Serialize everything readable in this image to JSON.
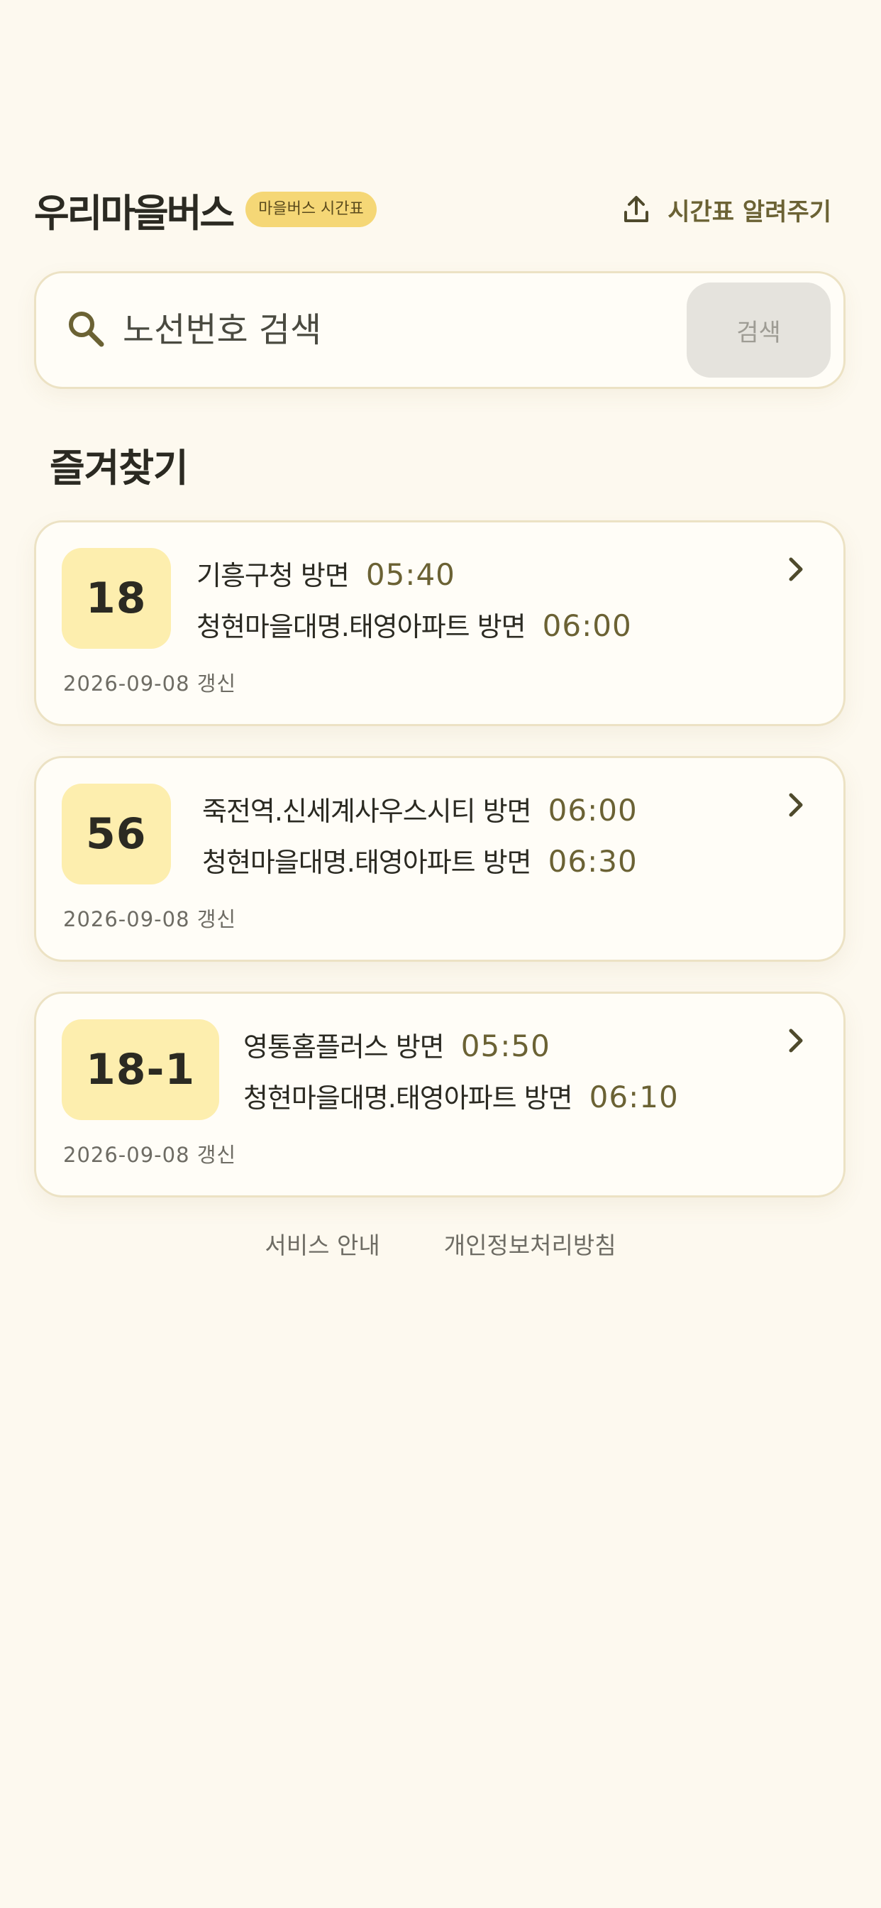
{
  "header": {
    "title": "우리마을버스",
    "badge": "마을버스 시간표",
    "share_label": "시간표 알려주기",
    "share_icon": "upload-icon"
  },
  "search": {
    "placeholder": "노선번호 검색",
    "button_label": "검색",
    "icon": "search-icon"
  },
  "favorites": {
    "title": "즐겨찾기",
    "routes": [
      {
        "number": "18",
        "directions": [
          {
            "name": "기흥구청 방면",
            "time": "05:40"
          },
          {
            "name": "청현마을대명.태영아파트 방면",
            "time": "06:00"
          }
        ],
        "updated": "2026-09-08 갱신"
      },
      {
        "number": "56",
        "directions": [
          {
            "name": "죽전역.신세계사우스시티 방면",
            "time": "06:00"
          },
          {
            "name": "청현마을대명.태영아파트 방면",
            "time": "06:30"
          }
        ],
        "updated": "2026-09-08 갱신"
      },
      {
        "number": "18-1",
        "directions": [
          {
            "name": "영통홈플러스 방면",
            "time": "05:50"
          },
          {
            "name": "청현마을대명.태영아파트 방면",
            "time": "06:10"
          }
        ],
        "updated": "2026-09-08 갱신"
      }
    ]
  },
  "footer": {
    "links": [
      "서비스 안내",
      "개인정보처리방침"
    ]
  },
  "colors": {
    "background": "#fdf9ef",
    "accent_badge": "#f5d776",
    "route_badge": "#fdeeae",
    "time_text": "#6b6234"
  }
}
